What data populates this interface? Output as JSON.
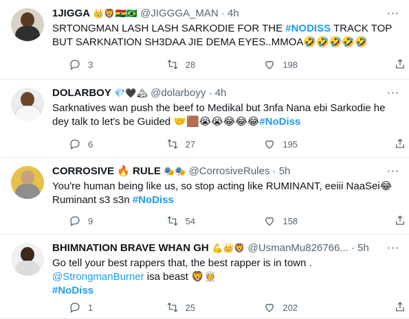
{
  "tweets": [
    {
      "name": "1JIGGA",
      "badges": "👑🦁🇬🇭🇧🇷",
      "handle": "@JIGGGA_MAN",
      "time": "4h",
      "text_before": "SRTONGMAN LASH LASH SARKODIE FOR THE ",
      "hashtag": "#NODISS",
      "text_after": " TRACK TOP BUT SARKNATION SH3DAA JIE DEMA EYES..MMOA🤣🤣🤣🤣🤣",
      "replies": "3",
      "retweets": "28",
      "likes": "198",
      "avatar_colors": {
        "bg": "#d9d3c7",
        "head": "#5a3a22",
        "body": "#2f2f2f"
      }
    },
    {
      "name": "DOLARBOY",
      "badges": "💎🖤🏔",
      "handle": "@dolarboyy",
      "time": "4h",
      "text_before": "Sarknatives wan push the beef to Medikal but 3nfa Nana ebi Sarkodie he dey talk to let's be Guided 🤝🟫😭😭😂😂😂",
      "hashtag": "#NoDiss",
      "text_after": "",
      "replies": "6",
      "retweets": "27",
      "likes": "195",
      "avatar_colors": {
        "bg": "#ececec",
        "head": "#6b4526",
        "body": "#eeeeee"
      }
    },
    {
      "name": "CORROSIVE 🔥 RULE",
      "badges": "🎭🎭",
      "handle": "@CorrosiveRules",
      "time": "5h",
      "text_before": "You're human being like us, so stop acting like RUMINANT, eeiii NaaSei😂 Ruminant s3 s3n ",
      "hashtag": "#NoDiss",
      "text_after": "",
      "replies": "9",
      "retweets": "54",
      "likes": "158",
      "avatar_colors": {
        "bg": "#e6c24a",
        "head": "#c9a27a",
        "body": "#8e8e8e"
      }
    },
    {
      "name": "BHIMNATION BRAVE WHAN GH",
      "badges": "💪👑🦁",
      "handle": "@UsmanMu826766...",
      "time": "5h",
      "text_before": "Go tell your best rappers that, the best rapper is in town .",
      "mention": "@StrongmanBurner",
      "mention_after": " isa beast 🦁👳",
      "hashtag": "#NoDiss",
      "text_after": "",
      "replies": "1",
      "retweets": "25",
      "likes": "202",
      "avatar_colors": {
        "bg": "#f0f0f0",
        "head": "#3d2a1e",
        "body": "#dcdcdc"
      }
    }
  ],
  "dot": "·",
  "more_icon": "···"
}
